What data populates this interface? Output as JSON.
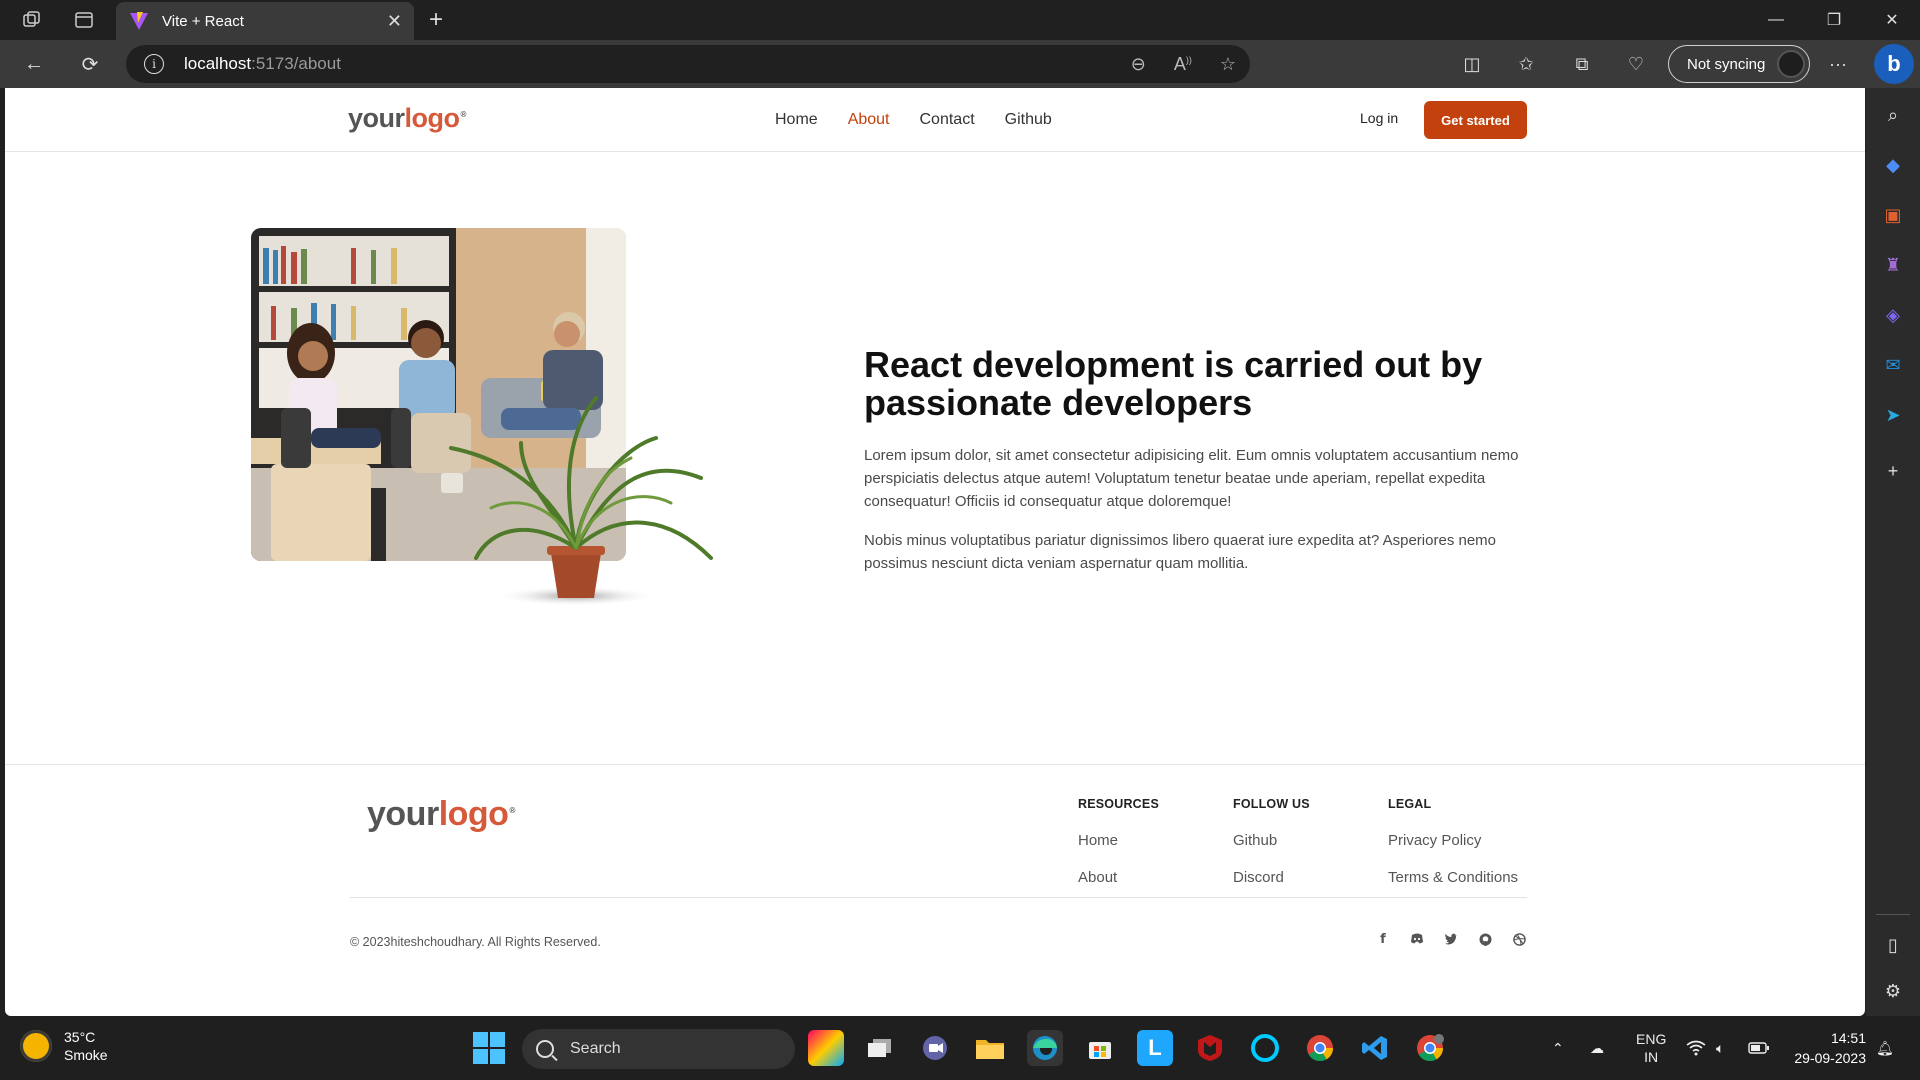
{
  "browser": {
    "tab_title": "Vite + React",
    "url_host": "localhost",
    "url_rest": ":5173/about",
    "sync_label": "Not syncing"
  },
  "site": {
    "logo_your": "your",
    "logo_logo": "logo",
    "nav": [
      "Home",
      "About",
      "Contact",
      "Github"
    ],
    "active_nav": "About",
    "login_label": "Log in",
    "cta_label": "Get started",
    "accent_color": "#c2410c"
  },
  "hero": {
    "title": "React development is carried out by passionate developers",
    "paragraph1": "Lorem ipsum dolor, sit amet consectetur adipisicing elit. Eum omnis voluptatem accusantium nemo perspiciatis delectus atque autem! Voluptatum tenetur beatae unde aperiam, repellat expedita consequatur! Officiis id consequatur atque doloremque!",
    "paragraph2": "Nobis minus voluptatibus pariatur dignissimos libero quaerat iure expedita at? Asperiores nemo possimus nesciunt dicta veniam aspernatur quam mollitia."
  },
  "footer": {
    "resources": {
      "heading": "RESOURCES",
      "links": [
        "Home",
        "About"
      ]
    },
    "follow": {
      "heading": "FOLLOW US",
      "links": [
        "Github",
        "Discord"
      ]
    },
    "legal": {
      "heading": "LEGAL",
      "links": [
        "Privacy Policy",
        "Terms & Conditions"
      ]
    },
    "copyright": "© 2023hiteshchoudhary. All Rights Reserved.",
    "social_icons": [
      "facebook-icon",
      "discord-icon",
      "twitter-icon",
      "github-icon",
      "dribbble-icon"
    ]
  },
  "taskbar": {
    "temperature": "35°C",
    "weather": "Smoke",
    "search_label": "Search",
    "lang": "ENG",
    "region": "IN",
    "time": "14:51",
    "date": "29-09-2023"
  }
}
